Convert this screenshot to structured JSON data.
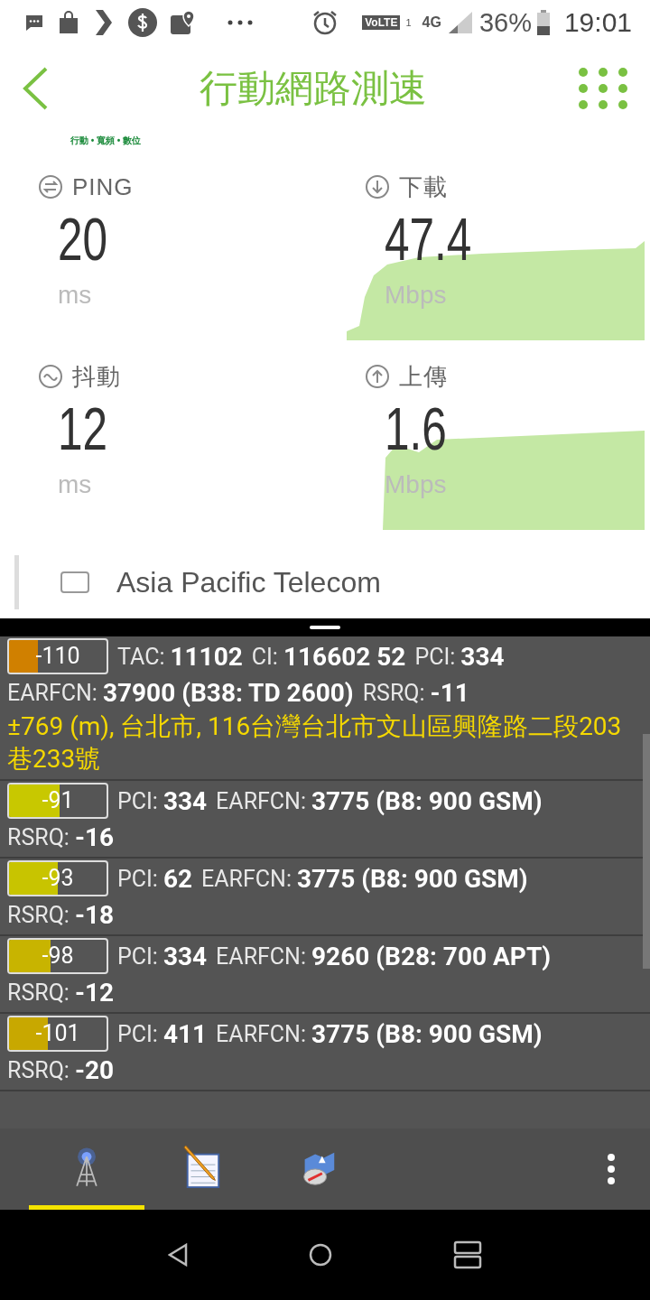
{
  "status_bar": {
    "volte": "VoLTE",
    "sim_slot": "1",
    "network": "4G",
    "battery": "36%",
    "time": "19:01"
  },
  "header": {
    "title": "行動網路測速"
  },
  "tagline": "行動 • 寬頻 • 數位",
  "metrics": [
    {
      "kind": "ping",
      "label": "PING",
      "value": "20",
      "unit": "ms"
    },
    {
      "kind": "download",
      "label": "下載",
      "value": "47.4",
      "unit": "Mbps"
    },
    {
      "kind": "jitter",
      "label": "抖動",
      "value": "12",
      "unit": "ms"
    },
    {
      "kind": "upload",
      "label": "上傳",
      "value": "1.6",
      "unit": "Mbps"
    }
  ],
  "operator": {
    "name": "Asia Pacific Telecom",
    "checked": false
  },
  "cells": [
    {
      "signal": "-110",
      "level": 0.3,
      "color": "#d08000",
      "lines": [
        [
          {
            "label": "TAC:",
            "value": "11102"
          },
          {
            "label": "CI:",
            "value": "116602 52"
          },
          {
            "label": "PCI:",
            "value": "334"
          }
        ],
        [
          {
            "label": "EARFCN:",
            "value": "37900 (B38: TD 2600)"
          },
          {
            "label": "RSRQ:",
            "value": "-11"
          }
        ]
      ],
      "location": "±769 (m), 台北市, 116台灣台北市文山區興隆路二段203巷233號"
    },
    {
      "signal": "-91",
      "level": 0.52,
      "color": "#c8c800",
      "lines": [
        [
          {
            "label": "PCI:",
            "value": "334"
          },
          {
            "label": "EARFCN:",
            "value": "3775 (B8: 900 GSM)"
          }
        ],
        [
          {
            "label": "RSRQ:",
            "value": "-16"
          }
        ]
      ]
    },
    {
      "signal": "-93",
      "level": 0.5,
      "color": "#c8c400",
      "lines": [
        [
          {
            "label": "PCI:",
            "value": "62"
          },
          {
            "label": "EARFCN:",
            "value": "3775 (B8: 900 GSM)"
          }
        ],
        [
          {
            "label": "RSRQ:",
            "value": "-18"
          }
        ]
      ]
    },
    {
      "signal": "-98",
      "level": 0.43,
      "color": "#c8b400",
      "lines": [
        [
          {
            "label": "PCI:",
            "value": "334"
          },
          {
            "label": "EARFCN:",
            "value": "9260 (B28: 700 APT)"
          }
        ],
        [
          {
            "label": "RSRQ:",
            "value": "-12"
          }
        ]
      ]
    },
    {
      "signal": "-101",
      "level": 0.4,
      "color": "#c8a800",
      "lines": [
        [
          {
            "label": "PCI:",
            "value": "411"
          },
          {
            "label": "EARFCN:",
            "value": "3775 (B8: 900 GSM)"
          }
        ],
        [
          {
            "label": "RSRQ:",
            "value": "-20"
          }
        ]
      ]
    }
  ],
  "tabs": [
    {
      "kind": "tower",
      "selected": true
    },
    {
      "kind": "notepad",
      "selected": false
    },
    {
      "kind": "map",
      "selected": false
    }
  ]
}
